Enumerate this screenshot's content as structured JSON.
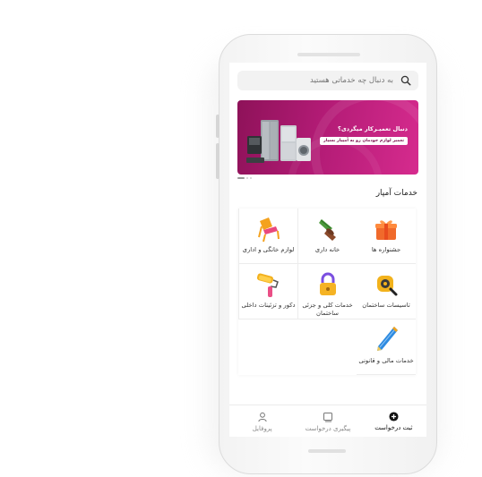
{
  "search": {
    "placeholder": "به دنبال چه خدماتی هستید",
    "icon": "search-icon"
  },
  "banner": {
    "headline": "دنبال تعمیـرکار میگردی؟",
    "subline": "تعمیر لوازم خودمان رو به آمپیار بسپار",
    "colors": {
      "start": "#8e1259",
      "end": "#d62b8e"
    },
    "slides_count": 3,
    "active_slide": 1
  },
  "section": {
    "title": "خدمات آمپار"
  },
  "services": [
    {
      "label": "جشنواره ها",
      "icon": "gift-box-icon"
    },
    {
      "label": "خانه داری",
      "icon": "cactus-pot-icon"
    },
    {
      "label": "لوازم خانگی و اداری",
      "icon": "chair-icon"
    },
    {
      "label": "تاسیسات ساختمان",
      "icon": "tape-measure-icon"
    },
    {
      "label": "خدمات کلی و جزئی ساختمان",
      "icon": "padlock-icon"
    },
    {
      "label": "دکور و تزئینات داخلی",
      "icon": "paint-roller-icon"
    },
    {
      "label": "خدمات مالی و قانونی",
      "icon": "pen-icon"
    }
  ],
  "tabs": [
    {
      "label": "ثبت درخواست",
      "icon": "plus-circle-icon",
      "active": true
    },
    {
      "label": "پیگیری درخواست",
      "icon": "request-tracking-icon",
      "active": false
    },
    {
      "label": "پروفایل",
      "icon": "user-icon",
      "active": false
    }
  ]
}
